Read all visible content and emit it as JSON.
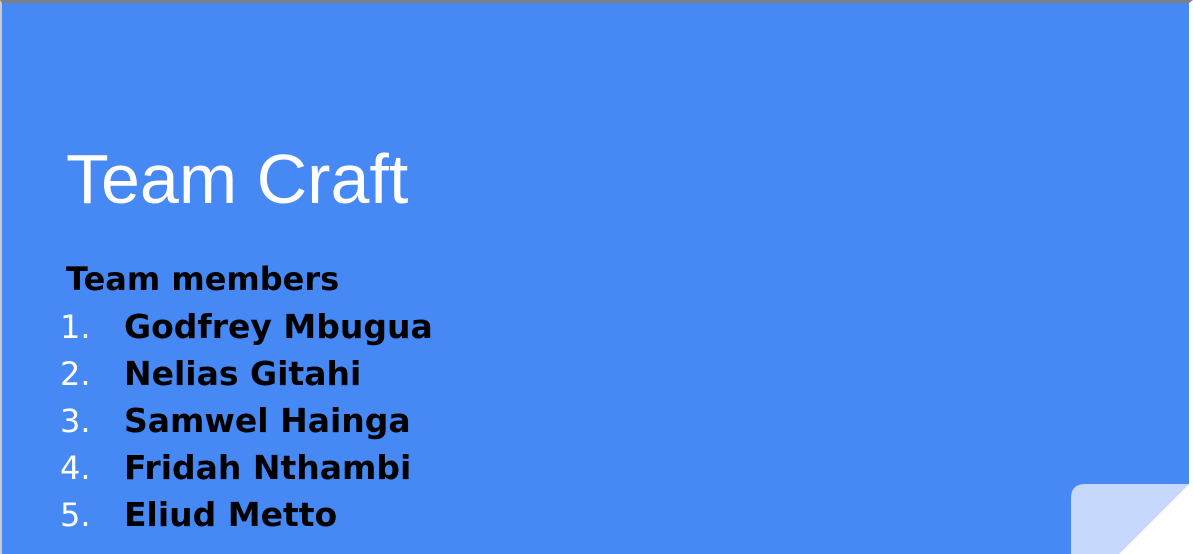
{
  "slide": {
    "title": "Team Craft",
    "subtitle": "Team members",
    "members": [
      {
        "number": "1.",
        "name": "Godfrey Mbugua"
      },
      {
        "number": "2.",
        "name": "Nelias Gitahi"
      },
      {
        "number": "3.",
        "name": "Samwel Hainga"
      },
      {
        "number": "4.",
        "name": "Fridah Nthambi"
      },
      {
        "number": "5.",
        "name": "Eliud Metto"
      }
    ]
  },
  "colors": {
    "background": "#4688f4",
    "title_text": "#ffffff",
    "body_text": "#000000",
    "number_text": "#ffffff",
    "corner_fold": "#c6d8fb"
  },
  "icons": {
    "corner": "page-curl-icon"
  }
}
